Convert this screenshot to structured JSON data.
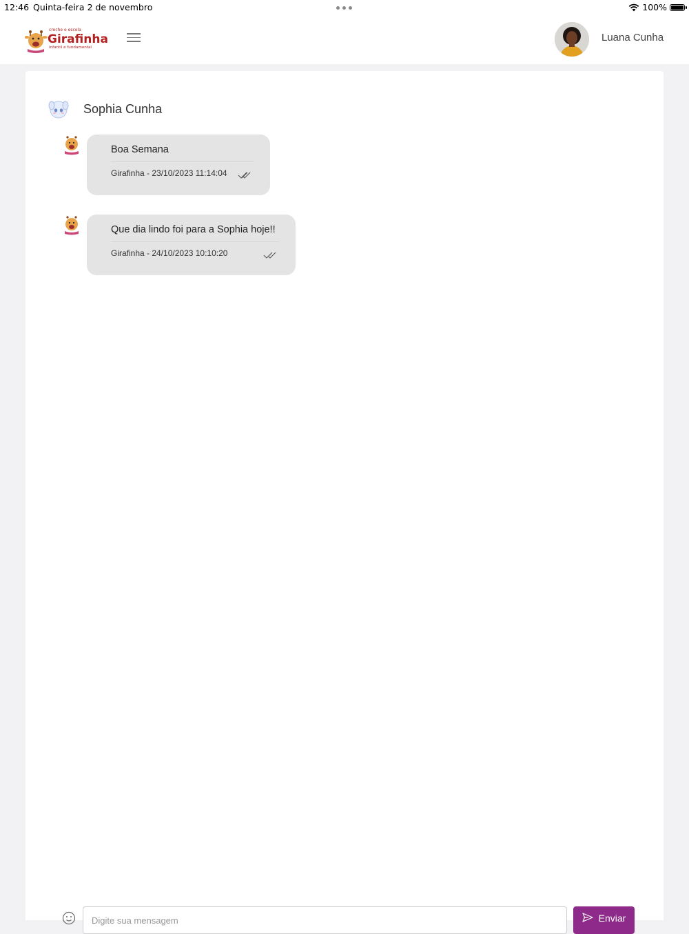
{
  "status_bar": {
    "time": "12:46",
    "date": "Quinta-feira 2 de novembro",
    "battery": "100%",
    "battery_level": 1.0
  },
  "header": {
    "logo": {
      "line1": "creche e escola",
      "name": "Girafinha",
      "line2": "infantil e fundamental"
    },
    "user_name": "Luana Cunha"
  },
  "chat": {
    "contact_name": "Sophia Cunha",
    "messages": [
      {
        "text": "Boa Semana",
        "meta": "Girafinha - 23/10/2023 11:14:04"
      },
      {
        "text": "Que dia lindo foi para a Sophia hoje!!",
        "meta": "Girafinha - 24/10/2023 10:10:20"
      }
    ]
  },
  "composer": {
    "placeholder": "Digite sua mensagem",
    "send_label": "Enviar"
  },
  "colors": {
    "accent": "#8e2a8a",
    "bubble": "#e4e4e4",
    "page_bg": "#f2f2f4",
    "logo_red": "#b32020"
  },
  "icons": [
    "wifi-icon",
    "battery-icon",
    "menu-icon",
    "double-check-icon",
    "emoji-icon",
    "send-icon"
  ]
}
